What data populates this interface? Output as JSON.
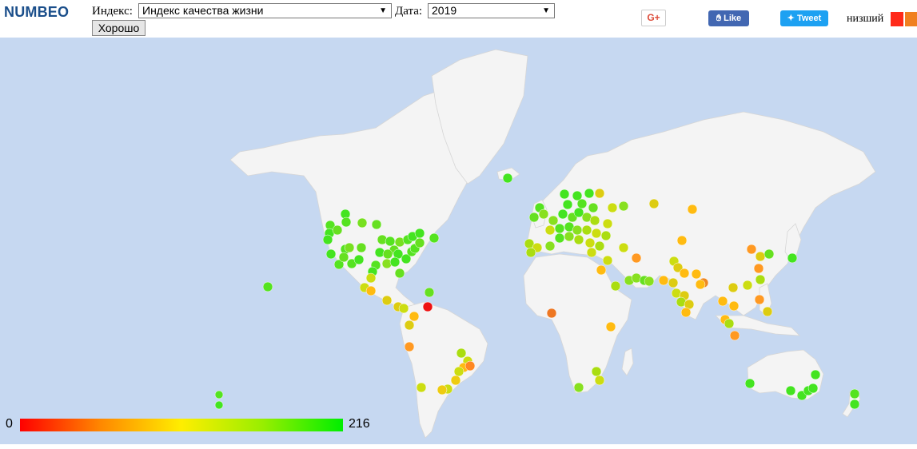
{
  "header": {
    "logo": "NUMBEO",
    "index_label": "Индекс:",
    "index_value": "Индекс качества жизни",
    "date_label": "Дата:",
    "date_value": "2019",
    "ok_button": "Хорошо",
    "gplus": "G+",
    "like": "Like",
    "tweet": "Tweet",
    "legend_low": "низший",
    "legend_colors": [
      "#ff2a1a",
      "#f08020"
    ]
  },
  "scale": {
    "min": "0",
    "max": "216"
  },
  "colors": {
    "ocean": "#c6d8f1",
    "land": "#f4f4f4",
    "border": "#d6d6d6"
  }
}
